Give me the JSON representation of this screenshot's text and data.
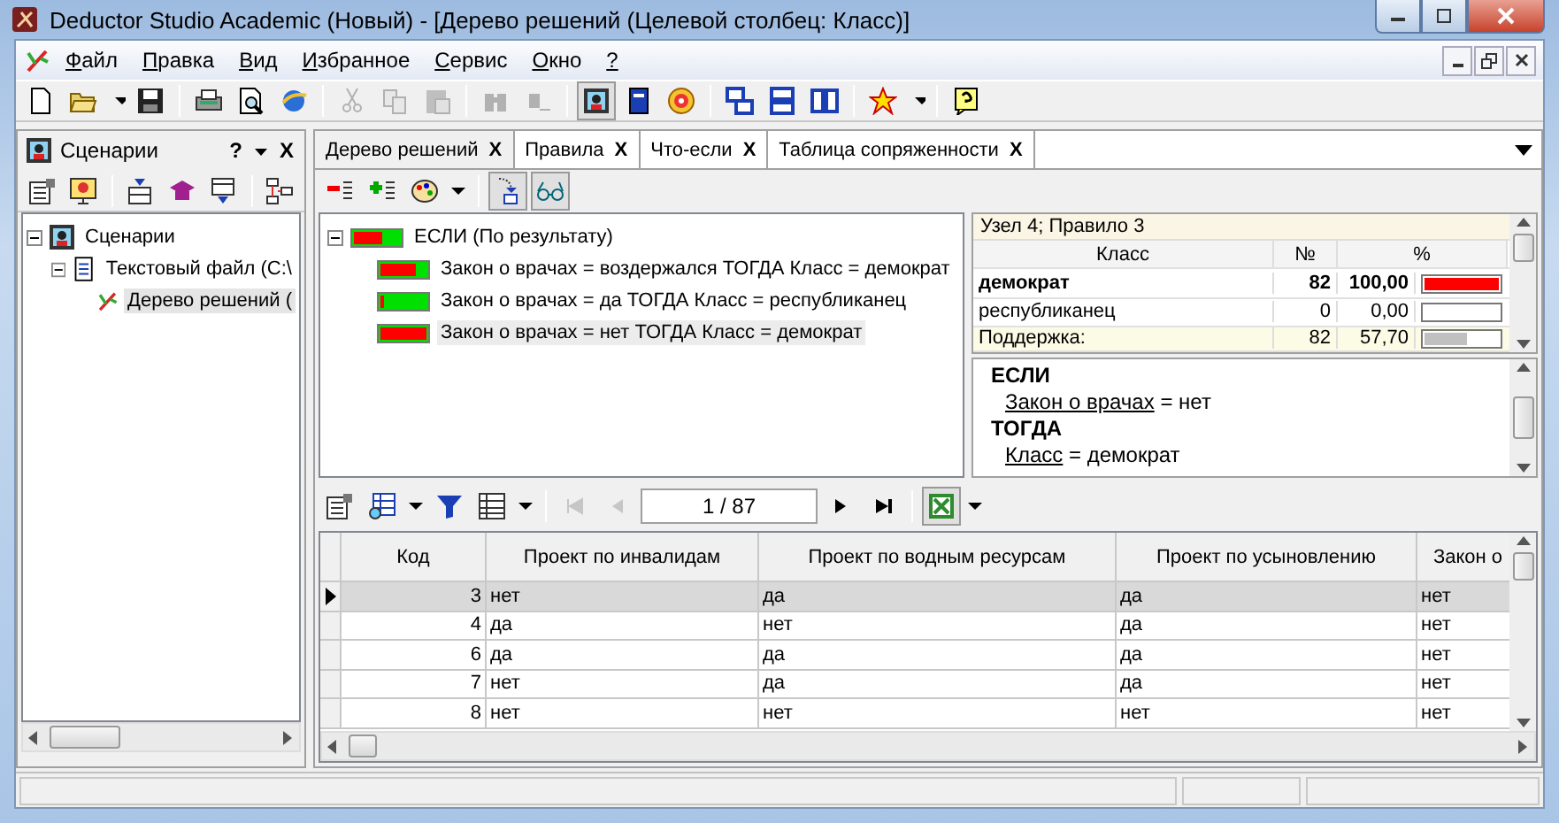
{
  "window": {
    "title": "Deductor Studio Academic (Новый) - [Дерево решений (Целевой столбец: Класс)]"
  },
  "menu": [
    {
      "label": "Файл"
    },
    {
      "label": "Правка"
    },
    {
      "label": "Вид"
    },
    {
      "label": "Избранное"
    },
    {
      "label": "Сервис"
    },
    {
      "label": "Окно"
    },
    {
      "label": "?"
    }
  ],
  "toolbar": [
    {
      "kind": "new",
      "disabled": false
    },
    {
      "kind": "open",
      "disabled": false
    },
    {
      "kind": "dropdown",
      "disabled": false
    },
    {
      "kind": "save",
      "disabled": false
    },
    {
      "kind": "separator"
    },
    {
      "kind": "print",
      "disabled": false
    },
    {
      "kind": "preview",
      "disabled": false
    },
    {
      "kind": "globe",
      "disabled": false
    },
    {
      "kind": "separator"
    },
    {
      "kind": "cut",
      "disabled": true
    },
    {
      "kind": "copy",
      "disabled": true
    },
    {
      "kind": "paste",
      "disabled": true
    },
    {
      "kind": "separator"
    },
    {
      "kind": "binoculars",
      "disabled": true
    },
    {
      "kind": "find-next",
      "disabled": true
    },
    {
      "kind": "separator"
    },
    {
      "kind": "portrait",
      "disabled": false,
      "pressed": true
    },
    {
      "kind": "book",
      "disabled": false
    },
    {
      "kind": "disc",
      "disabled": false
    },
    {
      "kind": "separator"
    },
    {
      "kind": "cascade",
      "disabled": false
    },
    {
      "kind": "tile-h",
      "disabled": false
    },
    {
      "kind": "tile-v",
      "disabled": false
    },
    {
      "kind": "separator"
    },
    {
      "kind": "star",
      "disabled": false
    },
    {
      "kind": "dropdown",
      "disabled": false
    },
    {
      "kind": "separator"
    },
    {
      "kind": "help",
      "disabled": false
    }
  ],
  "scenarios_panel": {
    "title": "Сценарии",
    "help": "?",
    "close": "X",
    "tree": [
      {
        "label": "Сценарии",
        "expanded": true,
        "selected": false,
        "children": [
          {
            "label": "Текстовый файл (C:\\",
            "expanded": true,
            "selected": false,
            "children": [
              {
                "label": "Дерево решений (",
                "selected": true
              }
            ]
          }
        ]
      }
    ]
  },
  "tabs": [
    {
      "label": "Дерево решений",
      "selected": true,
      "close": "X"
    },
    {
      "label": "Правила",
      "selected": false,
      "close": "X"
    },
    {
      "label": "Что-если",
      "selected": false,
      "close": "X"
    },
    {
      "label": "Таблица сопряженности",
      "selected": false,
      "close": "X"
    }
  ],
  "rules_tree": {
    "label": "ЕСЛИ (По результату)",
    "level": 0.6,
    "expanded": true,
    "children": [
      {
        "label": "Закон о врачах = воздержался ТОГДА Класс = демократ",
        "level": 0.75,
        "selected": false
      },
      {
        "label": "Закон о врачах = да ТОГДА Класс = республиканец",
        "level": 0.06,
        "selected": false
      },
      {
        "label": "Закон о врачах = нет ТОГДА Класс = демократ",
        "level": 1,
        "selected": true
      }
    ]
  },
  "node_info": {
    "title": "Узел 4; Правило 3",
    "columns": [
      "Класс",
      "№",
      "%"
    ],
    "rows": [
      {
        "kind": "class",
        "name": "демократ",
        "count": "82",
        "percent": "100,00",
        "level": 1,
        "predicted": true
      },
      {
        "kind": "class",
        "name": "республиканец",
        "count": "0",
        "percent": "0,00",
        "level": 0,
        "predicted": false
      },
      {
        "kind": "summary",
        "name": "Поддержка:",
        "count": "82",
        "percent": "57,70",
        "level": 0.577,
        "predicted": false
      }
    ]
  },
  "rule_text": {
    "if_label": "ЕСЛИ",
    "conditions": [
      {
        "field": "Закон о врачах",
        "op": "=",
        "value": "нет"
      }
    ],
    "then_label": "ТОГДА",
    "conclusion": {
      "field": "Класс",
      "op": "=",
      "value": "демократ"
    }
  },
  "navigator": {
    "position": "1 / 87"
  },
  "table": {
    "columns": [
      "Код",
      "Проект по инвалидам",
      "Проект по водным ресурсам",
      "Проект по усыновлению",
      "Закон о"
    ],
    "rows": [
      {
        "selected": true,
        "cells": [
          "3",
          "нет",
          "да",
          "да",
          "нет"
        ]
      },
      {
        "selected": false,
        "cells": [
          "4",
          "да",
          "нет",
          "да",
          "нет"
        ]
      },
      {
        "selected": false,
        "cells": [
          "6",
          "да",
          "да",
          "да",
          "нет"
        ]
      },
      {
        "selected": false,
        "cells": [
          "7",
          "нет",
          "да",
          "да",
          "нет"
        ]
      },
      {
        "selected": false,
        "cells": [
          "8",
          "нет",
          "нет",
          "нет",
          "нет"
        ]
      }
    ]
  }
}
